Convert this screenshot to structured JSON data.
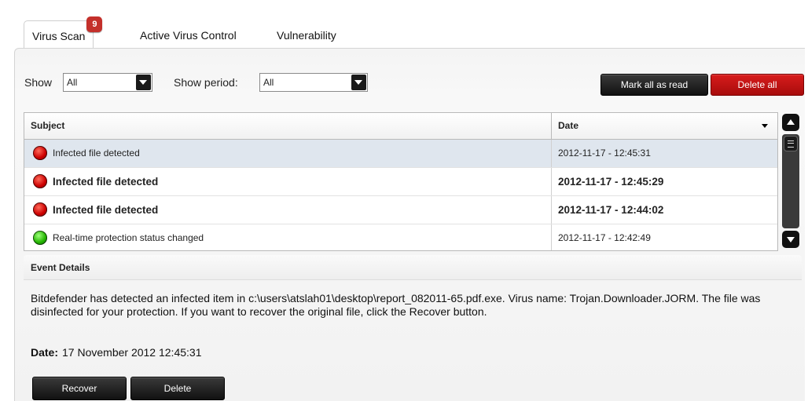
{
  "tabs": [
    {
      "label": "Virus Scan",
      "badge": "9"
    },
    {
      "label": "Active Virus Control"
    },
    {
      "label": "Vulnerability"
    }
  ],
  "filters": {
    "show_label": "Show",
    "show_value": "All",
    "period_label": "Show period:",
    "period_value": "All"
  },
  "actions": {
    "mark_all_read": "Mark all as read",
    "delete_all": "Delete all"
  },
  "table": {
    "headers": {
      "subject": "Subject",
      "date": "Date"
    },
    "rows": [
      {
        "subject": "Infected file detected",
        "date": "2012-11-17 - 12:45:31",
        "status": "red",
        "selected": true,
        "unread": false
      },
      {
        "subject": "Infected file detected",
        "date": "2012-11-17 - 12:45:29",
        "status": "red",
        "selected": false,
        "unread": true
      },
      {
        "subject": "Infected file detected",
        "date": "2012-11-17 - 12:44:02",
        "status": "red",
        "selected": false,
        "unread": true
      },
      {
        "subject": "Real-time protection status changed",
        "date": "2012-11-17 - 12:42:49",
        "status": "green",
        "selected": false,
        "unread": false
      }
    ]
  },
  "details": {
    "title": "Event Details",
    "body": "Bitdefender has detected an infected item in c:\\users\\atslah01\\desktop\\report_082011-65.pdf.exe. Virus name: Trojan.Downloader.JORM. The file was disinfected for your protection. If you want to recover the original file, click the Recover button.",
    "date_label": "Date:",
    "date_value": "17 November 2012 12:45:31",
    "recover_label": "Recover",
    "delete_label": "Delete"
  },
  "colors": {
    "accent_red": "#c4302b",
    "danger_button": "#b81212",
    "dark_button": "#1a1a1a",
    "selected_row": "#dfe6ee",
    "status_red": "#cc0000",
    "status_green": "#23b400"
  },
  "icons": [
    "chevron-down-icon",
    "sort-desc-icon",
    "status-red-icon",
    "status-green-icon",
    "scroll-up-icon",
    "scroll-down-icon",
    "scroll-thumb-icon"
  ]
}
